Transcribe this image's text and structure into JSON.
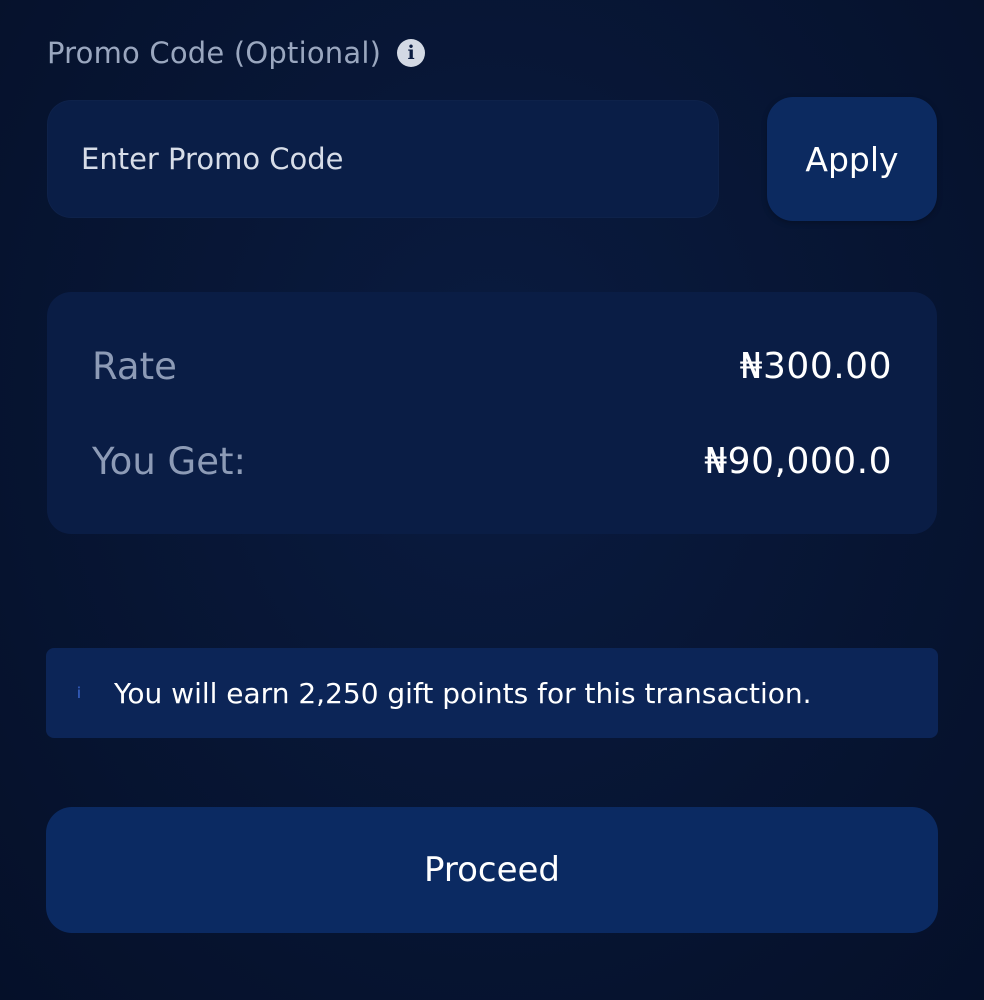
{
  "promo": {
    "label": "Promo Code (Optional)",
    "info_icon": "info-icon",
    "input_placeholder": "Enter Promo Code",
    "input_value": "",
    "apply_label": "Apply"
  },
  "summary": {
    "rate_label": "Rate",
    "rate_value": "₦300.00",
    "get_label": "You Get:",
    "get_value": "₦90,000.0"
  },
  "banner": {
    "icon": "info-icon",
    "icon_glyph": "i",
    "text": "You will earn 2,250 gift points for this transaction."
  },
  "actions": {
    "proceed_label": "Proceed"
  },
  "colors": {
    "background": "#061433",
    "card": "#0a1d45",
    "button": "#0b2a62",
    "muted_text": "#8d9bb6"
  }
}
